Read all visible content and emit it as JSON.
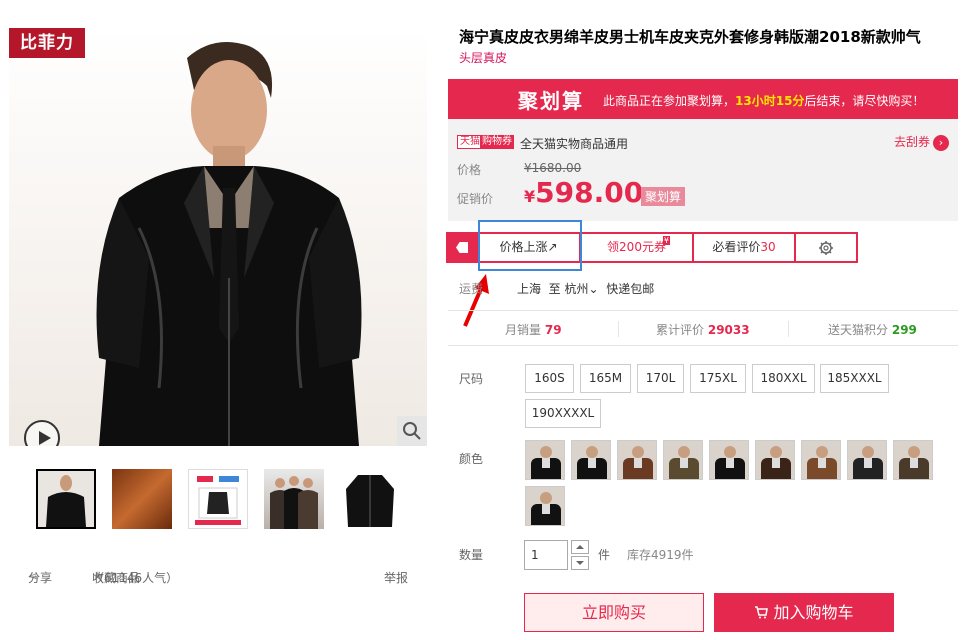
{
  "gallery": {
    "brand_badge": "比菲力",
    "actions": {
      "share_label": "分享",
      "favorite_label": "收藏商品",
      "favorite_count": "（61146人气）",
      "report_label": "举报"
    }
  },
  "product": {
    "title": "海宁真皮皮衣男绵羊皮男士机车皮夹克外套修身韩版潮2018新款帅气",
    "subtitle": "头层真皮"
  },
  "promo": {
    "logo": "聚划算",
    "text_before": "此商品正在参加聚划算，",
    "countdown": "13小时15分",
    "text_after": "后结束，请尽快购买！"
  },
  "coupon": {
    "tag_left": "天猫",
    "tag_right": "购物券",
    "desc": "全天猫实物商品通用",
    "link": "去刮券"
  },
  "price": {
    "label": "价格",
    "original": "¥1680.00",
    "promo_label": "促销价",
    "currency": "¥",
    "current": "598.00",
    "promo_tag": "聚划算"
  },
  "tools": {
    "price_up": "价格上涨↗",
    "coupon_prefix": "领",
    "coupon_amount": "200元券",
    "coupon_badge": "¥",
    "review_prefix": "必看评价",
    "review_count": "30"
  },
  "shipping": {
    "label": "运费",
    "from": "上海",
    "to_word": "至",
    "to": "杭州",
    "method": "快递包邮"
  },
  "stats": {
    "monthly_label": "月销量",
    "monthly_value": "79",
    "reviews_label": "累计评价",
    "reviews_value": "29033",
    "points_label": "送天猫积分",
    "points_value": "299"
  },
  "sizes": {
    "label": "尺码",
    "options": [
      "160S",
      "165M",
      "170L",
      "175XL",
      "180XXL",
      "185XXXL",
      "190XXXXL"
    ]
  },
  "colors": {
    "label": "颜色"
  },
  "quantity": {
    "label": "数量",
    "value": "1",
    "unit": "件",
    "stock": "库存4919件"
  },
  "buttons": {
    "buy_now": "立即购买",
    "add_cart": "加入购物车"
  },
  "colors_theme": {
    "accent": "#e5284d",
    "highlight": "#3d86d8"
  }
}
